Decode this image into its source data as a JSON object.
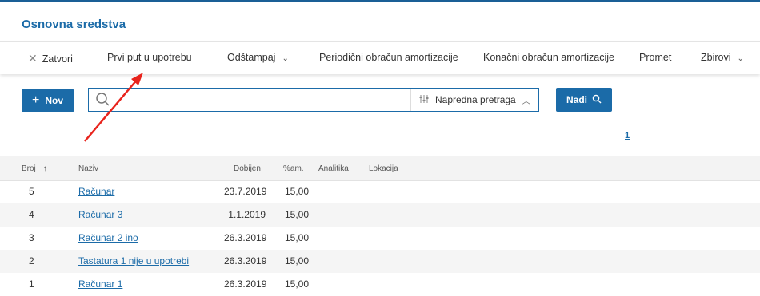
{
  "header": {
    "title": "Osnovna sredstva"
  },
  "toolbar": {
    "close_label": "Zatvori",
    "first_use_label": "Prvi put u upotrebu",
    "print_label": "Odštampaj",
    "periodic_label": "Periodični obračun amortizacije",
    "final_label": "Konačni obračun amortizacije",
    "turnover_label": "Promet",
    "totals_label": "Zbirovi"
  },
  "actions": {
    "new_label": "Nov",
    "search_placeholder": "",
    "advanced_label": "Napredna pretraga",
    "find_label": "Nađi"
  },
  "pager": {
    "current": "1"
  },
  "table": {
    "columns": [
      "Broj",
      "Naziv",
      "Dobijen",
      "%am.",
      "Analitika",
      "Lokacija"
    ],
    "rows": [
      {
        "broj": "5",
        "naziv": "Računar",
        "dobijen": "23.7.2019",
        "am": "15,00"
      },
      {
        "broj": "4",
        "naziv": "Računar 3",
        "dobijen": "1.1.2019",
        "am": "15,00"
      },
      {
        "broj": "3",
        "naziv": "Računar 2 ino",
        "dobijen": "26.3.2019",
        "am": "15,00"
      },
      {
        "broj": "2",
        "naziv": "Tastatura 1 nije u upotrebi",
        "dobijen": "26.3.2019",
        "am": "15,00"
      },
      {
        "broj": "1",
        "naziv": "Računar 1",
        "dobijen": "26.3.2019",
        "am": "15,00"
      }
    ]
  },
  "colors": {
    "accent": "#1b6ba8",
    "annotation_arrow": "#e8231c"
  }
}
